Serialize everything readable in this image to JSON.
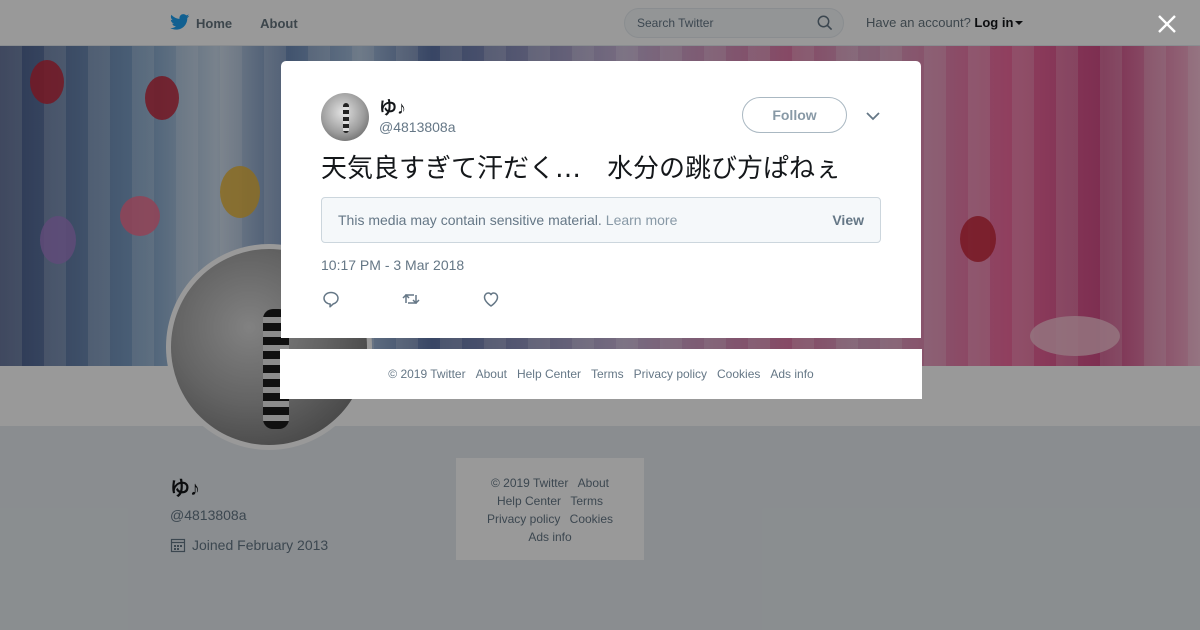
{
  "topbar": {
    "nav": [
      {
        "label": "Home",
        "icon": "twitter-bird-icon"
      },
      {
        "label": "About"
      }
    ],
    "search": {
      "placeholder": "Search Twitter",
      "icon": "search-icon"
    },
    "login": {
      "prefix": "Have an account?",
      "link": "Log in"
    }
  },
  "profile": {
    "name": "ゆ♪",
    "handle": "@4813808a",
    "joined": "Joined February 2013"
  },
  "side_footer": {
    "items": [
      "© 2019 Twitter",
      "About",
      "Help Center",
      "Terms",
      "Privacy policy",
      "Cookies",
      "Ads info"
    ]
  },
  "tweet": {
    "name": "ゆ♪",
    "handle": "@4813808a",
    "follow_label": "Follow",
    "text": "天気良すぎて汗だく…　水分の跳び方ぱねぇ",
    "sensitive_message": "This media may contain sensitive material.",
    "learn_more": "Learn more",
    "view_label": "View",
    "timestamp": "10:17 PM - 3 Mar 2018"
  },
  "modal_footer": {
    "items": [
      "© 2019 Twitter",
      "About",
      "Help Center",
      "Terms",
      "Privacy policy",
      "Cookies",
      "Ads info"
    ]
  },
  "colors": {
    "twitter_blue": "#1da1f2",
    "muted_text": "#657786",
    "overlay": "rgba(0,0,0,0.4)"
  }
}
